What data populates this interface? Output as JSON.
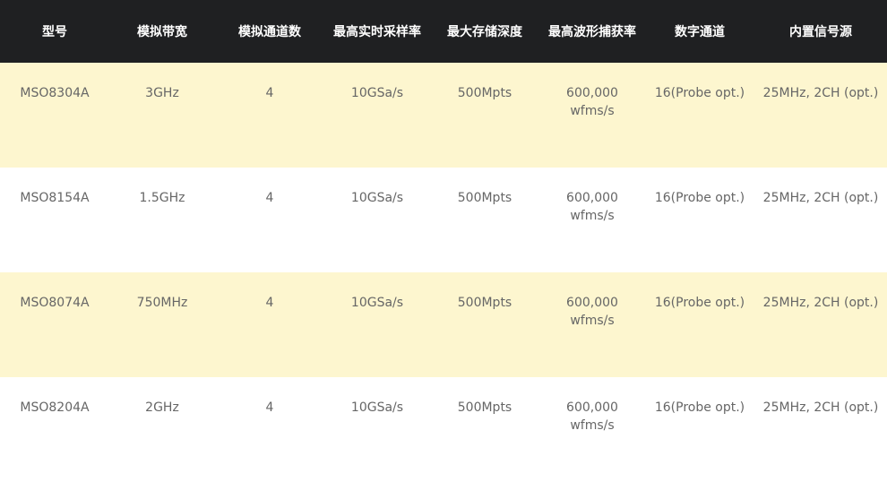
{
  "table": {
    "headers": [
      "型号",
      "模拟带宽",
      "模拟通道数",
      "最高实时采样率",
      "最大存储深度",
      "最高波形捕获率",
      "数字通道",
      "内置信号源"
    ],
    "rows": [
      [
        "MSO8304A",
        "3GHz",
        "4",
        "10GSa/s",
        "500Mpts",
        "600,000 wfms/s",
        "16(Probe opt.)",
        "25MHz, 2CH (opt.)"
      ],
      [
        "MSO8154A",
        "1.5GHz",
        "4",
        "10GSa/s",
        "500Mpts",
        "600,000 wfms/s",
        "16(Probe opt.)",
        "25MHz, 2CH (opt.)"
      ],
      [
        "MSO8074A",
        "750MHz",
        "4",
        "10GSa/s",
        "500Mpts",
        "600,000 wfms/s",
        "16(Probe opt.)",
        "25MHz, 2CH (opt.)"
      ],
      [
        "MSO8204A",
        "2GHz",
        "4",
        "10GSa/s",
        "500Mpts",
        "600,000 wfms/s",
        "16(Probe opt.)",
        "25MHz, 2CH (opt.)"
      ]
    ]
  },
  "colors": {
    "header_bg": "#1f2022",
    "header_text": "#ffffff",
    "row_alt_bg": "#fdf6cf",
    "row_bg": "#ffffff",
    "cell_text": "#666666"
  }
}
